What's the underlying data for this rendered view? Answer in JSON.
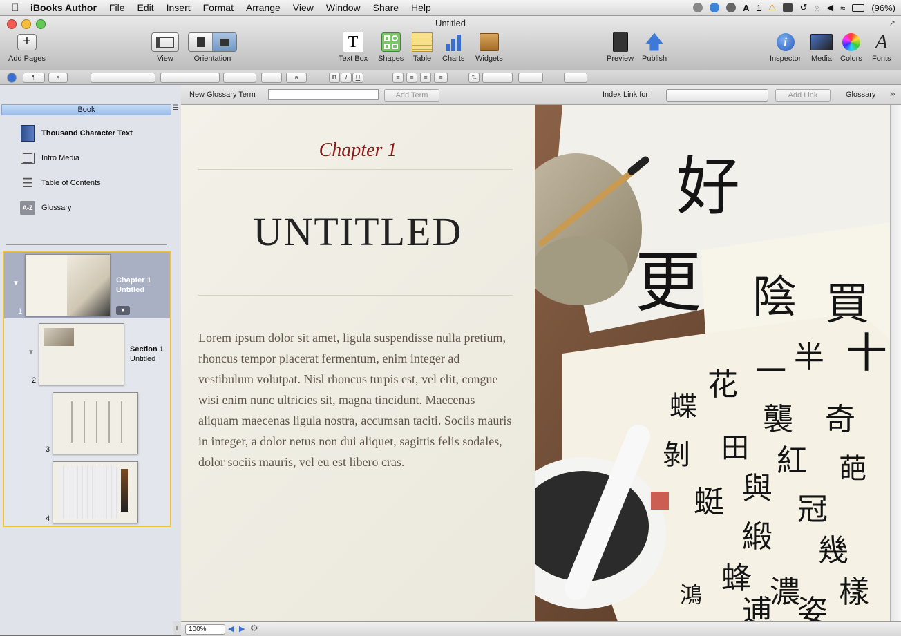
{
  "menubar": {
    "app_name": "iBooks Author",
    "items": [
      "File",
      "Edit",
      "Insert",
      "Format",
      "Arrange",
      "View",
      "Window",
      "Share",
      "Help"
    ],
    "status": {
      "adobe_count": "1",
      "battery": "(96%)"
    }
  },
  "window": {
    "title": "Untitled",
    "toolbar": {
      "add_pages": "Add Pages",
      "view": "View",
      "orientation": "Orientation",
      "text_box": "Text Box",
      "shapes": "Shapes",
      "table": "Table",
      "charts": "Charts",
      "widgets": "Widgets",
      "preview": "Preview",
      "publish": "Publish",
      "inspector": "Inspector",
      "media": "Media",
      "colors": "Colors",
      "fonts": "Fonts"
    },
    "format_bar": {
      "char_style": "a",
      "sample_a": "a",
      "bold": "B",
      "italic": "I",
      "underline": "U"
    }
  },
  "glossary_bar": {
    "new_term_label": "New Glossary Term",
    "new_term_value": "",
    "add_term": "Add Term",
    "index_link_label": "Index Link for:",
    "add_link": "Add Link",
    "glossary": "Glossary"
  },
  "sidebar": {
    "header": "Book",
    "nav_items": [
      {
        "label": "Thousand Character Text",
        "icon": "book-cover-icon"
      },
      {
        "label": "Intro Media",
        "icon": "film-strip-icon"
      },
      {
        "label": "Table of Contents",
        "icon": "list-icon"
      },
      {
        "label": "Glossary",
        "icon": "a-z-icon"
      }
    ],
    "chapter": {
      "line1": "Chapter 1",
      "line2": "Untitled",
      "page": "1"
    },
    "section": {
      "line1": "Section 1",
      "line2": "Untitled",
      "page": "2"
    },
    "pages": [
      "3",
      "4"
    ]
  },
  "document": {
    "chapter_label": "Chapter 1",
    "title": "UNTITLED",
    "body": "Lorem ipsum dolor sit amet, ligula suspendisse nulla pretium, rhoncus tempor placerat fermentum, enim integer ad vestibulum volutpat. Nisl rhoncus turpis est, vel elit, congue wisi enim nunc ultricies sit, magna tincidunt. Maecenas aliquam maecenas ligula nostra, accumsan taciti. Sociis mauris in integer, a dolor netus non dui aliquet, sagittis felis sodales, dolor sociis mauris, vel eu est libero cras."
  },
  "bottom_bar": {
    "zoom": "100%"
  },
  "colors": {
    "accent": "#8a1a1a",
    "selection": "#f1c33b",
    "sidebar_selected": "#a9b0c4"
  }
}
